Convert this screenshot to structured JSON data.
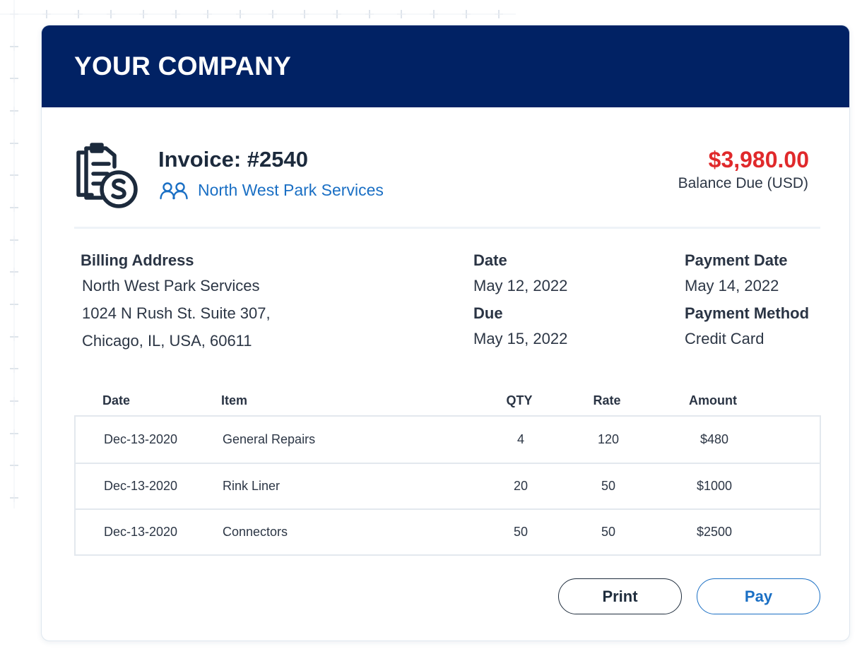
{
  "header": {
    "company_name": "YOUR COMPANY"
  },
  "invoice": {
    "title": "Invoice: #2540",
    "client_name": "North West Park Services",
    "balance_amount": "$3,980.00",
    "balance_label": "Balance Due (USD)"
  },
  "billing": {
    "label": "Billing Address",
    "lines": [
      "North West Park Services",
      "1024 N Rush St. Suite 307,",
      "Chicago, IL, USA, 60611"
    ]
  },
  "dates": {
    "date_label": "Date",
    "date_value": "May 12, 2022",
    "due_label": "Due",
    "due_value": "May 15, 2022"
  },
  "payment": {
    "date_label": "Payment Date",
    "date_value": "May 14, 2022",
    "method_label": "Payment Method",
    "method_value": "Credit Card"
  },
  "table": {
    "headers": [
      "Date",
      "Item",
      "QTY",
      "Rate",
      "Amount"
    ],
    "rows": [
      [
        "Dec-13-2020",
        "General Repairs",
        "4",
        "120",
        "$480"
      ],
      [
        "Dec-13-2020",
        "Rink Liner",
        "20",
        "50",
        "$1000"
      ],
      [
        "Dec-13-2020",
        "Connectors",
        "50",
        "50",
        "$2500"
      ]
    ]
  },
  "actions": {
    "print_label": "Print",
    "pay_label": "Pay"
  },
  "colors": {
    "header_bg": "#012264",
    "accent_blue": "#1a6fc4",
    "balance_red": "#e0292b",
    "text_dark": "#1f2d3d"
  },
  "icons": {
    "invoice": "invoice-dollar-icon",
    "client": "people-icon"
  }
}
